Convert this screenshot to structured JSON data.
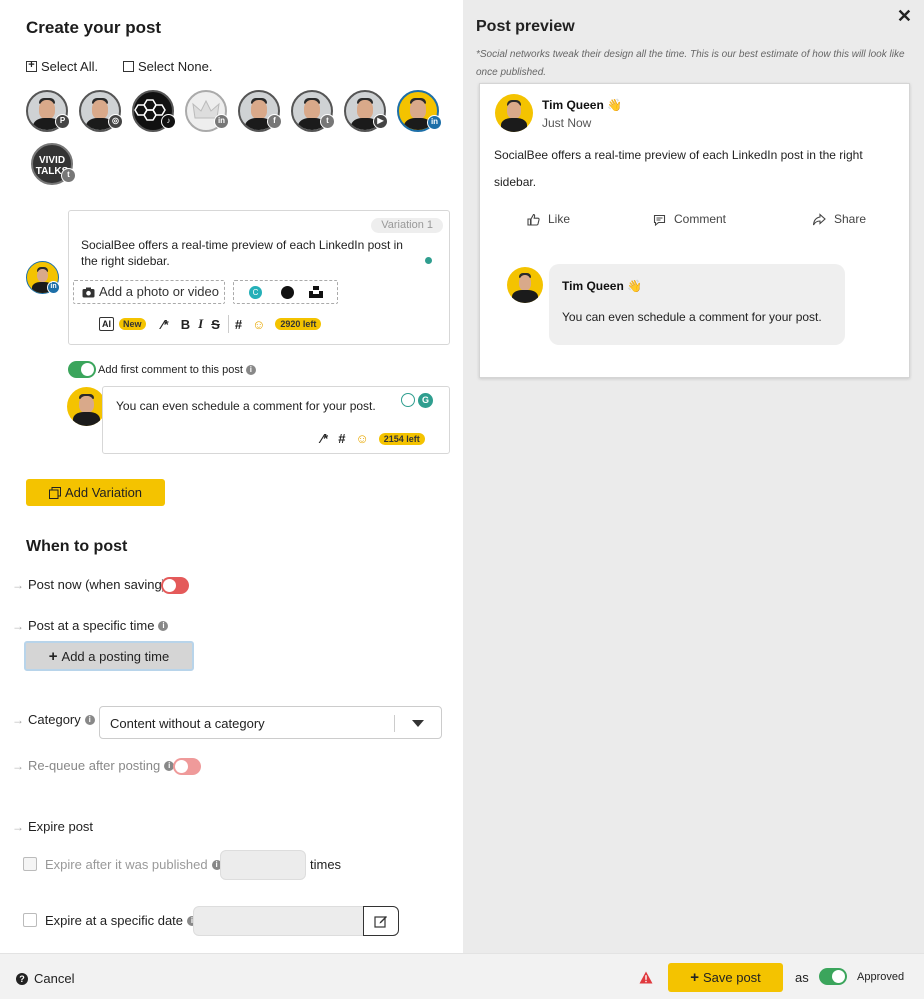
{
  "composer": {
    "title": "Create your post",
    "select_all": "Select All.",
    "select_none": "Select None.",
    "profiles": [
      {
        "network": "pinterest-icon",
        "color": "#444"
      },
      {
        "network": "instagram-icon",
        "color": "#444"
      },
      {
        "network": "tiktok-icon",
        "color": "#111"
      },
      {
        "network": "linkedin-icon",
        "color": "#777"
      },
      {
        "network": "facebook-icon",
        "color": "#777"
      },
      {
        "network": "twitter-icon",
        "color": "#777"
      },
      {
        "network": "youtube-icon",
        "color": "#444"
      },
      {
        "network": "linkedin-icon",
        "color": "#1d6fa8",
        "selected": true
      }
    ],
    "vivid_talks_label": "VIVID TALKS",
    "variation_label": "Variation 1",
    "post_text": "SocialBee offers a real-time preview of each LinkedIn post in the right sidebar.",
    "add_media_label": "Add a photo or video",
    "new_badge": "New",
    "chars_left": "2920 left",
    "first_comment_label": "Add first comment to this post",
    "comment_text": "You can even schedule a comment for your post.",
    "comment_chars_left": "2154 left",
    "add_variation_label": "Add Variation"
  },
  "schedule": {
    "title": "When to post",
    "post_now_label": "Post now (when saving)",
    "specific_time_label": "Post at a specific time",
    "add_time_label": "Add a posting time",
    "category_label": "Category",
    "category_value": "Content without a category",
    "requeue_label": "Re-queue after posting",
    "expire_label": "Expire post",
    "expire_after_label": "Expire after it was published",
    "times_label": "times",
    "expire_date_label": "Expire at a specific date"
  },
  "preview": {
    "title": "Post preview",
    "note": "*Social networks tweak their design all the time. This is our best estimate of how this will look like once published.",
    "author": "Tim Queen",
    "author_emoji": "👋",
    "timestamp": "Just Now",
    "body": "SocialBee offers a real-time preview of each LinkedIn post in the right sidebar.",
    "actions": {
      "like": "Like",
      "comment": "Comment",
      "share": "Share"
    },
    "comment_author": "Tim Queen",
    "comment_text": "You can even schedule a comment for your post."
  },
  "footer": {
    "cancel_label": "Cancel",
    "save_label": "Save post",
    "as_label": "as",
    "status_label": "Approved"
  },
  "colors": {
    "accent": "#f4c300",
    "toggle_on": "#3ba55c",
    "toggle_off": "#e45a5a",
    "linkedin": "#1d6fa8"
  }
}
